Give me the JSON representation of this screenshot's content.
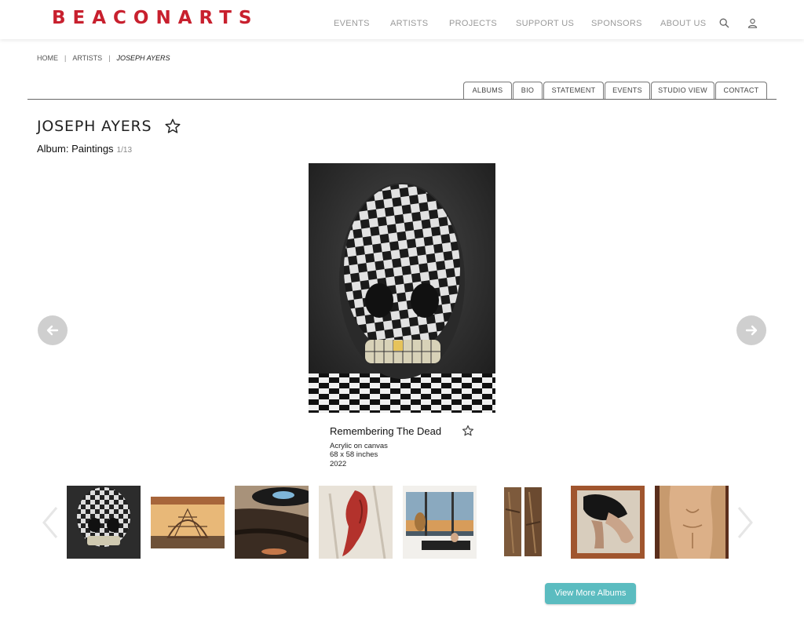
{
  "brand": {
    "logo": "BEACONARTS",
    "color": "#c8202e"
  },
  "nav": {
    "items": [
      "EVENTS",
      "ARTISTS",
      "PROJECTS",
      "SUPPORT US",
      "SPONSORS",
      "ABOUT US"
    ],
    "icons": [
      "search-icon",
      "user-icon"
    ]
  },
  "breadcrumb": {
    "home": "HOME",
    "section": "ARTISTS",
    "current": "JOSEPH AYERS"
  },
  "tabs": [
    "ALBUMS",
    "BIO",
    "STATEMENT",
    "EVENTS",
    "STUDIO VIEW",
    "CONTACT"
  ],
  "artist": {
    "name": "JOSEPH AYERS"
  },
  "album": {
    "label": "Album: Paintings",
    "count": "1/13"
  },
  "artwork": {
    "title": "Remembering The Dead",
    "medium": "Acrylic on canvas",
    "size": "68 x 58 inches",
    "year": "2022"
  },
  "thumbnails": [
    "checkered skull painting",
    "geodesic dome painting",
    "saucer interior painting",
    "red figure painting",
    "interior window painting",
    "wood sculpture",
    "figure with dark cloth painting",
    "torso painting"
  ],
  "buttons": {
    "view_more": "View More Albums"
  },
  "colors": {
    "accent": "#5bbcc0",
    "nav_text": "#9a9a9a"
  }
}
